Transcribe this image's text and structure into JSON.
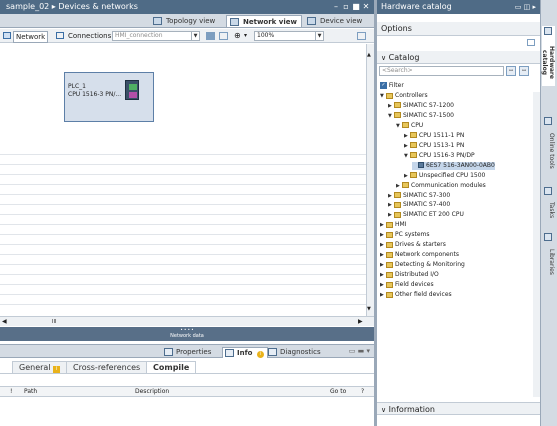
{
  "editor": {
    "title": "sample_02 ▸ Devices & networks",
    "views": {
      "topology": "Topology view",
      "network": "Network view",
      "device": "Device view"
    },
    "toolbar": {
      "network": "Network",
      "connections": "Connections",
      "connection_type": "HMI_connection",
      "zoom": "100%"
    },
    "plc": {
      "name": "PLC_1",
      "type": "CPU 1516-3 PN/..."
    },
    "network_data_label": "Network data"
  },
  "inspector": {
    "tabs": {
      "properties": "Properties",
      "info": "Info",
      "diagnostics": "Diagnostics"
    },
    "subtabs": {
      "general": "General",
      "crossref": "Cross-references",
      "compile": "Compile"
    },
    "columns": {
      "path": "Path",
      "description": "Description",
      "goto": "Go to",
      "q": "?"
    }
  },
  "catalog": {
    "title": "Hardware catalog",
    "options_label": "Options",
    "catalog_label": "Catalog",
    "search_placeholder": "<Search>",
    "filter_label": "Filter",
    "tree": [
      {
        "label": "Controllers",
        "level": 0,
        "open": true,
        "kind": "folder"
      },
      {
        "label": "SIMATIC S7-1200",
        "level": 1,
        "open": false,
        "kind": "folder"
      },
      {
        "label": "SIMATIC S7-1500",
        "level": 1,
        "open": true,
        "kind": "folder"
      },
      {
        "label": "CPU",
        "level": 2,
        "open": true,
        "kind": "folder"
      },
      {
        "label": "CPU 1511-1 PN",
        "level": 3,
        "open": false,
        "kind": "folder"
      },
      {
        "label": "CPU 1513-1 PN",
        "level": 3,
        "open": false,
        "kind": "folder"
      },
      {
        "label": "CPU 1516-3 PN/DP",
        "level": 3,
        "open": true,
        "kind": "folder"
      },
      {
        "label": "6ES7 516-3AN00-0AB0",
        "level": 4,
        "open": null,
        "kind": "module",
        "selected": true
      },
      {
        "label": "Unspecified CPU 1500",
        "level": 3,
        "open": false,
        "kind": "folder"
      },
      {
        "label": "Communication modules",
        "level": 2,
        "open": false,
        "kind": "folder"
      },
      {
        "label": "SIMATIC S7-300",
        "level": 1,
        "open": false,
        "kind": "folder"
      },
      {
        "label": "SIMATIC S7-400",
        "level": 1,
        "open": false,
        "kind": "folder"
      },
      {
        "label": "SIMATIC ET 200 CPU",
        "level": 1,
        "open": false,
        "kind": "folder"
      },
      {
        "label": "HMI",
        "level": 0,
        "open": false,
        "kind": "folder"
      },
      {
        "label": "PC systems",
        "level": 0,
        "open": false,
        "kind": "folder"
      },
      {
        "label": "Drives & starters",
        "level": 0,
        "open": false,
        "kind": "folder"
      },
      {
        "label": "Network components",
        "level": 0,
        "open": false,
        "kind": "folder"
      },
      {
        "label": "Detecting & Monitoring",
        "level": 0,
        "open": false,
        "kind": "folder"
      },
      {
        "label": "Distributed I/O",
        "level": 0,
        "open": false,
        "kind": "folder"
      },
      {
        "label": "Field devices",
        "level": 0,
        "open": false,
        "kind": "folder"
      },
      {
        "label": "Other field devices",
        "level": 0,
        "open": false,
        "kind": "folder"
      }
    ],
    "information_label": "Information"
  },
  "sidetabs": {
    "hw": "Hardware catalog",
    "online": "Online tools",
    "tasks": "Tasks",
    "libraries": "Libraries"
  }
}
